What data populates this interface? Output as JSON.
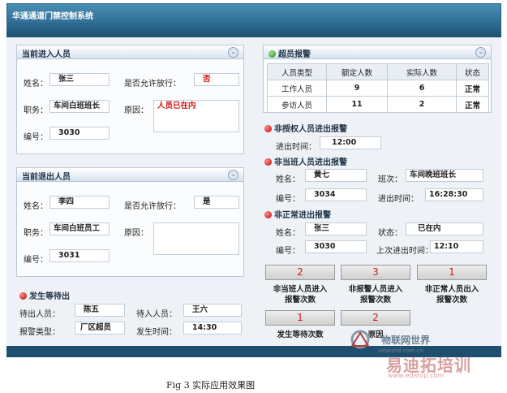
{
  "window": {
    "title": "华通通道门禁控制系统"
  },
  "current_in": {
    "title": "当前进入人员",
    "name_label": "姓名：",
    "name": "张三",
    "allow_label": "是否允许放行：",
    "allow": "否",
    "job_label": "职务：",
    "job": "车间白班班长",
    "reason_label": "原因：",
    "reason": "人员已在内",
    "id_label": "编号：",
    "id": "3030"
  },
  "current_out": {
    "title": "当前退出人员",
    "name_label": "姓名：",
    "name": "李四",
    "allow_label": "是否允许放行：",
    "allow": "是",
    "job_label": "职务：",
    "job": "车间白班员工",
    "reason_label": "原因：",
    "reason": "",
    "id_label": "编号：",
    "id": "3031"
  },
  "wait": {
    "title": "发生等待出",
    "waiting_label": "待出人员：",
    "waiting": "陈五",
    "waiting_in_label": "待入人员：",
    "waiting_in": "王六",
    "alarm_type_label": "报警类型：",
    "alarm_type": "厂区超员",
    "time_label": "发生时间：",
    "time": "14:30"
  },
  "over": {
    "title": "超员报警",
    "headers": [
      "人员类型",
      "额定人数",
      "实际人数",
      "状态"
    ],
    "rows": [
      [
        "工作人员",
        "9",
        "6",
        "正常"
      ],
      [
        "参访人员",
        "11",
        "2",
        "正常"
      ]
    ]
  },
  "unauth": {
    "title": "非授权人员进出报警",
    "time_label": "进出时间：",
    "time": "12:00"
  },
  "offshift": {
    "title": "非当班人员进出报警",
    "name_label": "姓名：",
    "name": "黄七",
    "shift_label": "班次：",
    "shift": "车间晚班班长",
    "id_label": "编号：",
    "id": "3034",
    "time_label": "进出时间：",
    "time": "16:28:30"
  },
  "abnormal": {
    "title": "非正常进出报警",
    "name_label": "姓名：",
    "name": "张三",
    "state_label": "状态：",
    "state": "已在内",
    "id_label": "编号：",
    "id": "3030",
    "last_label": "上次进出时间：",
    "last": "12:10"
  },
  "counters": [
    {
      "value": "2",
      "label1": "非当班人员进入",
      "label2": "报警次数"
    },
    {
      "value": "3",
      "label1": "非报警人员进入",
      "label2": "报警次数"
    },
    {
      "value": "1",
      "label1": "非正常人员出入",
      "label2": "报警次数"
    },
    {
      "value": "1",
      "label1": "发生等待次数",
      "label2": ""
    },
    {
      "value": "2",
      "label1": "原因",
      "label2": ""
    }
  ],
  "caption": "Fig 3  实际应用效果图",
  "watermark": {
    "line1": "物联网世界",
    "line2": "iotworld.com.cn",
    "line3": "易迪拓培训",
    "line4": "www.edatop.com"
  },
  "colors": {
    "titlebar": "#3c80a8",
    "alert_red": "#d01010",
    "ok_green": "#2e8b17"
  }
}
